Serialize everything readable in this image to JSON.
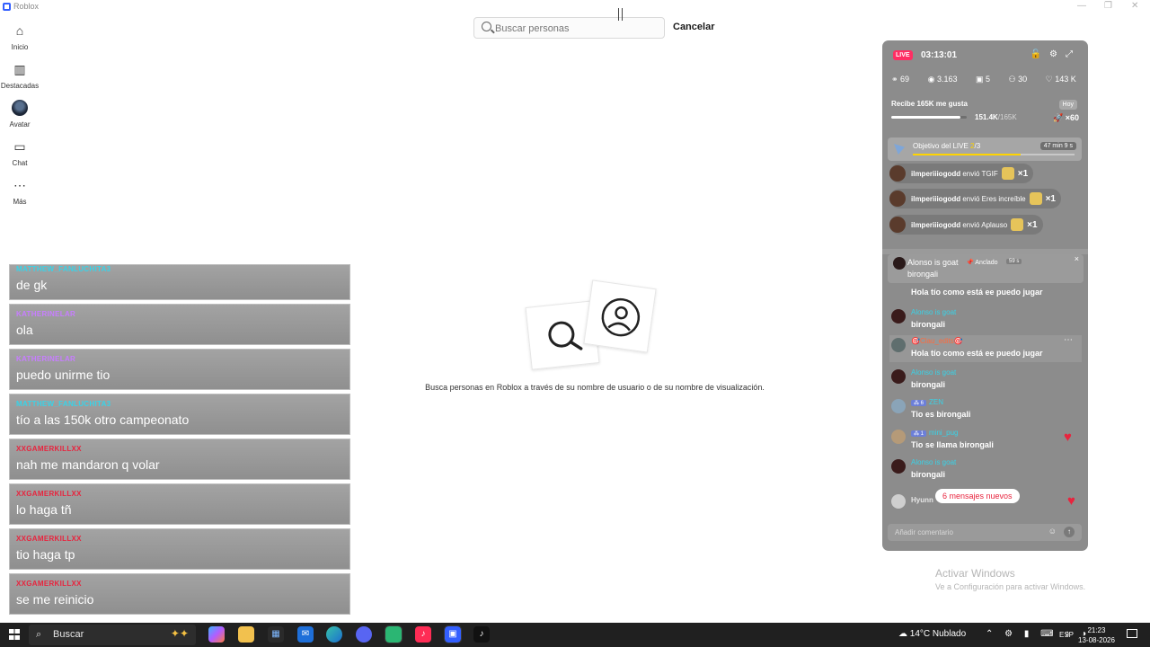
{
  "window": {
    "title": "Roblox",
    "controls": [
      "—",
      "❐",
      "✕"
    ]
  },
  "nav": [
    {
      "label": "Inicio",
      "icon": "home-icon",
      "glyph": "⌂"
    },
    {
      "label": "Destacadas",
      "icon": "chart-icon",
      "glyph": "▥"
    },
    {
      "label": "Avatar",
      "icon": "avatar-icon",
      "glyph": ""
    },
    {
      "label": "Chat",
      "icon": "chat-icon",
      "glyph": "▭"
    },
    {
      "label": "Más",
      "icon": "more-icon",
      "glyph": "⋯"
    }
  ],
  "search": {
    "placeholder": "Buscar personas",
    "value": "",
    "cancel_label": "Cancelar"
  },
  "empty_state": {
    "text": "Busca personas en Roblox a través de su nombre de usuario o de su nombre de visualización."
  },
  "overlay_chat": [
    {
      "name": "MATTHEW_FANLUCHITA3",
      "message": "de gk",
      "color": "#38d3e8"
    },
    {
      "name": "KATHERINELAR",
      "message": "ola",
      "color": "#c77dff"
    },
    {
      "name": "KATHERINELAR",
      "message": "puedo unirme tio",
      "color": "#c77dff"
    },
    {
      "name": "MATTHEW_FANLUCHITA3",
      "message": "tío a las 150k otro campeonato",
      "color": "#38d3e8"
    },
    {
      "name": "XXGAMERKILLXX",
      "message": "nah me mandaron q volar",
      "color": "#e8243e"
    },
    {
      "name": "XXGAMERKILLXX",
      "message": "lo haga tñ",
      "color": "#e8243e"
    },
    {
      "name": "XXGAMERKILLXX",
      "message": "tio haga tp",
      "color": "#e8243e"
    },
    {
      "name": "XXGAMERKILLXX",
      "message": "se me reinicio",
      "color": "#e8243e"
    }
  ],
  "live": {
    "badge": "LIVE",
    "timer": "03:13:01",
    "header_icons": "🔓⚙⤢",
    "stats": {
      "guests": "69",
      "viewers": "3.163",
      "gifts": "5",
      "shares": "30",
      "likes": "143 K"
    },
    "goal": {
      "title": "Recibe 165K me gusta",
      "current": "151.4K",
      "max": "/165K",
      "today": "Hoy",
      "multiplier": "×60",
      "progress": 0.917
    },
    "objective": {
      "label": "Objetivo del LIVE ",
      "step": "2",
      "total": "/3",
      "time": "47 min 9 s",
      "progress": 0.667
    },
    "gifts": [
      {
        "user": "ilmperiiiogodd",
        "action": " envió TGIF",
        "count": "×1"
      },
      {
        "user": "ilmperiiiogodd",
        "action": " envió Eres increíble",
        "count": "×1"
      },
      {
        "user": "ilmperiiiogodd",
        "action": " envió Aplauso",
        "count": "×1"
      }
    ],
    "pinned": {
      "name": "Alonso is goat",
      "tag": "📌 Anclado",
      "ago": "59 s",
      "text": "birongali",
      "close": "×"
    },
    "comments": [
      {
        "name": "",
        "badge": "",
        "text": "Hola tío como está ee puedo jugar",
        "white": false
      },
      {
        "name": "Alonso is goat",
        "badge": "",
        "text": "birongali",
        "white": false
      },
      {
        "name": "🎯Clau_edits🎯",
        "badge": "",
        "text": "Hola tío como está ee puedo jugar",
        "white": false,
        "more": "⋯"
      },
      {
        "name": "Alonso is goat",
        "badge": "",
        "text": "birongali",
        "white": false
      },
      {
        "name": "ZEN",
        "badge": "⁂ 6",
        "text": "Tio es birongali",
        "white": false
      },
      {
        "name": "mini_pug",
        "badge": "⁂ 1",
        "text": "Tio se llama birongali",
        "white": false
      },
      {
        "name": "Alonso is goat",
        "badge": "",
        "text": "birongali",
        "white": false
      }
    ],
    "partial_name": "Hyunn",
    "new_messages": "6 mensajes nuevos",
    "comment_placeholder": "Añadir comentario"
  },
  "watermark": {
    "line1": "Activar Windows",
    "line2": "Ve a Configuración para activar Windows."
  },
  "taskbar": {
    "search_label": "Buscar",
    "weather": "14°C  Nublado",
    "lang": "ESP",
    "time": "21:23",
    "date": "13-08-2026"
  }
}
